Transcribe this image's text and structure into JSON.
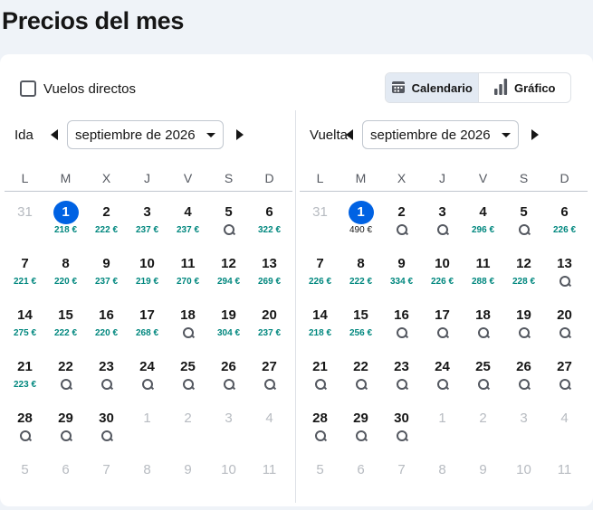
{
  "title": "Precios del mes",
  "filters": {
    "direct_label": "Vuelos directos",
    "direct_checked": false
  },
  "view_toggle": {
    "calendar_label": "Calendario",
    "chart_label": "Gráfico",
    "active": "calendar"
  },
  "weekday_headers": [
    "L",
    "M",
    "X",
    "J",
    "V",
    "S",
    "D"
  ],
  "outbound": {
    "label": "Ida",
    "month": "septiembre de 2026",
    "days": [
      {
        "d": "31",
        "muted": true
      },
      {
        "d": "1",
        "price": "218 €",
        "selected": true
      },
      {
        "d": "2",
        "price": "222 €"
      },
      {
        "d": "3",
        "price": "237 €"
      },
      {
        "d": "4",
        "price": "237 €"
      },
      {
        "d": "5",
        "search": true
      },
      {
        "d": "6",
        "price": "322 €"
      },
      {
        "d": "7",
        "price": "221 €"
      },
      {
        "d": "8",
        "price": "220 €"
      },
      {
        "d": "9",
        "price": "237 €"
      },
      {
        "d": "10",
        "price": "219 €"
      },
      {
        "d": "11",
        "price": "270 €"
      },
      {
        "d": "12",
        "price": "294 €"
      },
      {
        "d": "13",
        "price": "269 €"
      },
      {
        "d": "14",
        "price": "275 €"
      },
      {
        "d": "15",
        "price": "222 €"
      },
      {
        "d": "16",
        "price": "220 €"
      },
      {
        "d": "17",
        "price": "268 €"
      },
      {
        "d": "18",
        "search": true
      },
      {
        "d": "19",
        "price": "304 €"
      },
      {
        "d": "20",
        "price": "237 €"
      },
      {
        "d": "21",
        "price": "223 €"
      },
      {
        "d": "22",
        "search": true
      },
      {
        "d": "23",
        "search": true
      },
      {
        "d": "24",
        "search": true
      },
      {
        "d": "25",
        "search": true
      },
      {
        "d": "26",
        "search": true
      },
      {
        "d": "27",
        "search": true
      },
      {
        "d": "28",
        "search": true
      },
      {
        "d": "29",
        "search": true
      },
      {
        "d": "30",
        "search": true
      },
      {
        "d": "1",
        "muted": true
      },
      {
        "d": "2",
        "muted": true
      },
      {
        "d": "3",
        "muted": true
      },
      {
        "d": "4",
        "muted": true
      },
      {
        "d": "5",
        "muted": true
      },
      {
        "d": "6",
        "muted": true
      },
      {
        "d": "7",
        "muted": true
      },
      {
        "d": "8",
        "muted": true
      },
      {
        "d": "9",
        "muted": true
      },
      {
        "d": "10",
        "muted": true
      },
      {
        "d": "11",
        "muted": true
      }
    ]
  },
  "return": {
    "label": "Vuelta",
    "month": "septiembre de 2026",
    "days": [
      {
        "d": "31",
        "muted": true
      },
      {
        "d": "1",
        "price": "490 €",
        "selected": true,
        "dark": true
      },
      {
        "d": "2",
        "search": true
      },
      {
        "d": "3",
        "search": true
      },
      {
        "d": "4",
        "price": "296 €"
      },
      {
        "d": "5",
        "search": true
      },
      {
        "d": "6",
        "price": "226 €"
      },
      {
        "d": "7",
        "price": "226 €"
      },
      {
        "d": "8",
        "price": "222 €"
      },
      {
        "d": "9",
        "price": "334 €"
      },
      {
        "d": "10",
        "price": "226 €"
      },
      {
        "d": "11",
        "price": "288 €"
      },
      {
        "d": "12",
        "price": "228 €"
      },
      {
        "d": "13",
        "search": true
      },
      {
        "d": "14",
        "price": "218 €"
      },
      {
        "d": "15",
        "price": "256 €"
      },
      {
        "d": "16",
        "search": true
      },
      {
        "d": "17",
        "search": true
      },
      {
        "d": "18",
        "search": true
      },
      {
        "d": "19",
        "search": true
      },
      {
        "d": "20",
        "search": true
      },
      {
        "d": "21",
        "search": true
      },
      {
        "d": "22",
        "search": true
      },
      {
        "d": "23",
        "search": true
      },
      {
        "d": "24",
        "search": true
      },
      {
        "d": "25",
        "search": true
      },
      {
        "d": "26",
        "search": true
      },
      {
        "d": "27",
        "search": true
      },
      {
        "d": "28",
        "search": true
      },
      {
        "d": "29",
        "search": true
      },
      {
        "d": "30",
        "search": true
      },
      {
        "d": "1",
        "muted": true
      },
      {
        "d": "2",
        "muted": true
      },
      {
        "d": "3",
        "muted": true
      },
      {
        "d": "4",
        "muted": true
      },
      {
        "d": "5",
        "muted": true
      },
      {
        "d": "6",
        "muted": true
      },
      {
        "d": "7",
        "muted": true
      },
      {
        "d": "8",
        "muted": true
      },
      {
        "d": "9",
        "muted": true
      },
      {
        "d": "10",
        "muted": true
      },
      {
        "d": "11",
        "muted": true
      }
    ]
  },
  "colors": {
    "price": "#00877e",
    "selected": "#0062e3",
    "muted": "#b7bbc1"
  }
}
